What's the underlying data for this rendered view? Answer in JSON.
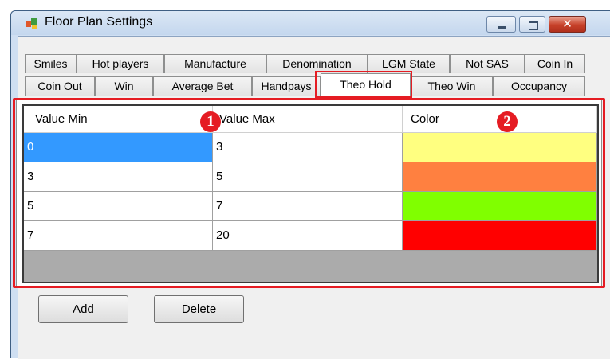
{
  "window": {
    "title": "Floor Plan Settings",
    "icon": "app-window-icon",
    "controls": {
      "minimize": "minimize",
      "maximize": "maximize",
      "close": "✕"
    }
  },
  "tabs_row1": [
    "Smiles",
    "Hot players",
    "Manufacture",
    "Denomination",
    "LGM State",
    "Not SAS",
    "Coin In"
  ],
  "tabs_row2": [
    "Coin Out",
    "Win",
    "Average Bet",
    "Handpays",
    "Theo Hold",
    "Theo Win",
    "Occupancy"
  ],
  "active_tab": "Theo Hold",
  "grid": {
    "columns": [
      "Value Min",
      "Value Max",
      "Color"
    ],
    "rows": [
      {
        "min": "0",
        "max": "3",
        "color": "#ffff80"
      },
      {
        "min": "3",
        "max": "5",
        "color": "#ff8040"
      },
      {
        "min": "5",
        "max": "7",
        "color": "#80ff00"
      },
      {
        "min": "7",
        "max": "20",
        "color": "#ff0000"
      }
    ],
    "selected": {
      "row": 0,
      "column": "min"
    }
  },
  "callouts": [
    "1",
    "2"
  ],
  "buttons": {
    "add": "Add",
    "delete": "Delete"
  },
  "highlight_color": "#e51c23",
  "selection_color": "#3399ff"
}
